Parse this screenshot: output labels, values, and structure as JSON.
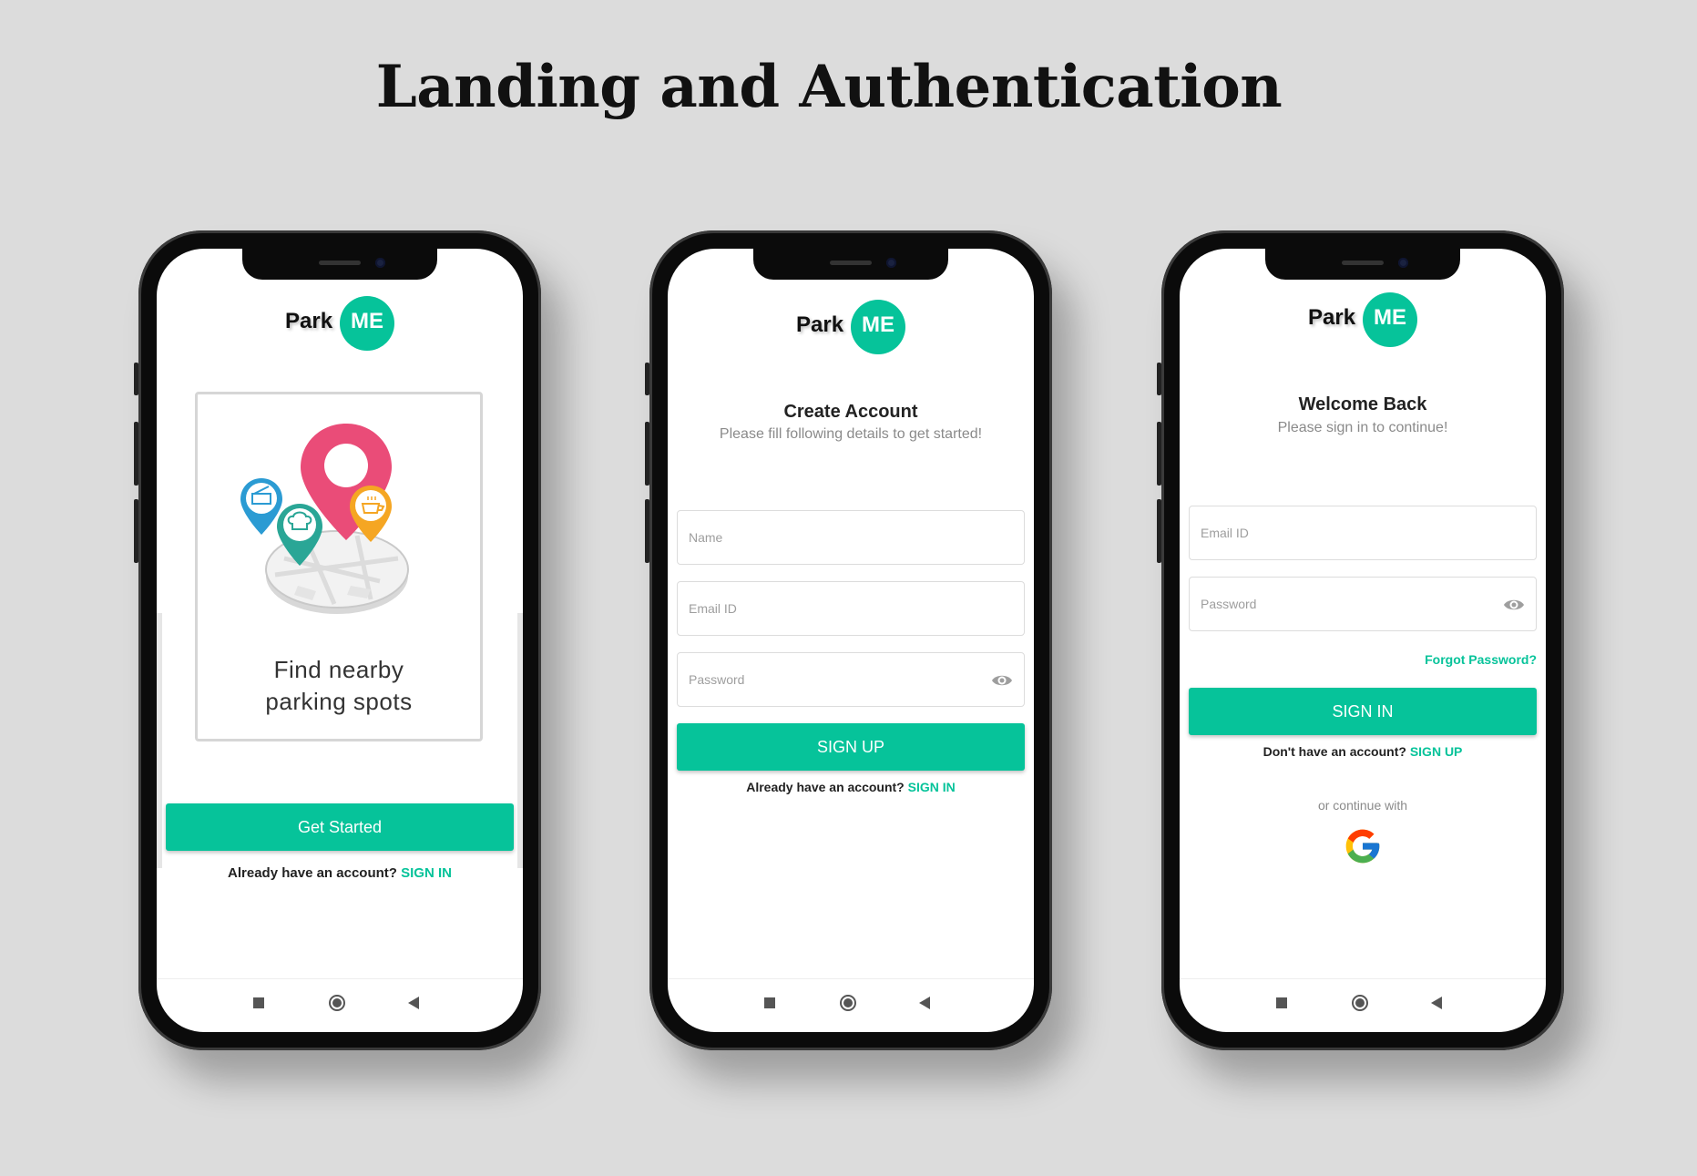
{
  "page": {
    "title": "Landing and Authentication"
  },
  "brand": {
    "name_park": "Park",
    "name_me": "ME",
    "accent": "#06c39a"
  },
  "landing": {
    "caption_line1": "Find nearby",
    "caption_line2": "parking spots",
    "cta_label": "Get Started",
    "footer_text": "Already have an account?",
    "footer_link": "SIGN IN"
  },
  "signup": {
    "heading": "Create Account",
    "subheading": "Please fill following details to get started!",
    "name_placeholder": "Name",
    "email_placeholder": "Email ID",
    "password_placeholder": "Password",
    "cta_label": "SIGN UP",
    "footer_text": "Already have an account?",
    "footer_link": "SIGN IN"
  },
  "signin": {
    "heading": "Welcome Back",
    "subheading": "Please sign in to continue!",
    "email_placeholder": "Email ID",
    "password_placeholder": "Password",
    "forgot_label": "Forgot Password?",
    "cta_label": "SIGN IN",
    "footer_text": "Don't have an account?",
    "footer_link": "SIGN UP",
    "or_text": "or continue with",
    "google_icon": "google-icon"
  },
  "icons": {
    "eye": "eye-icon",
    "nav_recents": "square-icon",
    "nav_home": "circle-home-icon",
    "nav_back": "triangle-back-icon"
  }
}
